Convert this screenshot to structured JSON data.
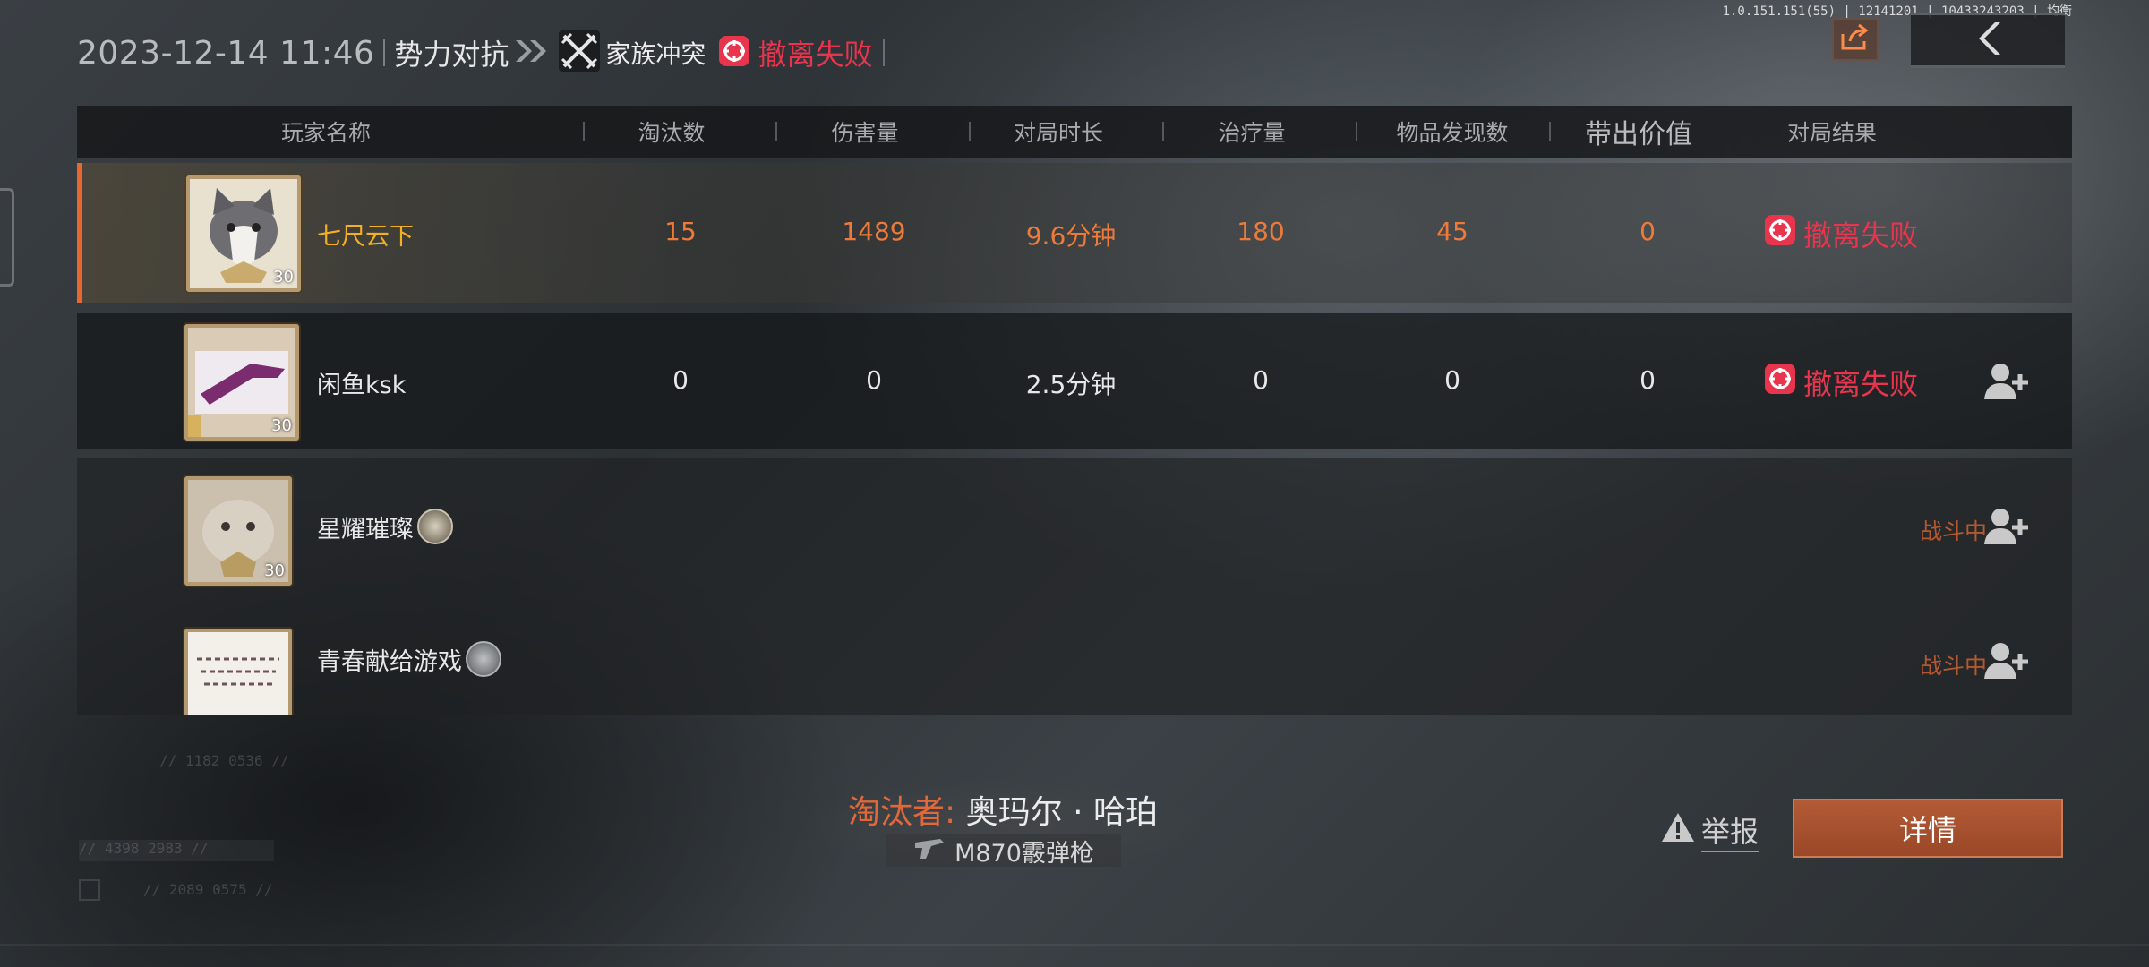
{
  "header": {
    "datetime": "2023-12-14 11:46",
    "mode": "势力对抗",
    "submode": "家族冲突",
    "result": "撤离失败"
  },
  "version": "1.0.151.151(55) | 12141201 | 10433243203 | 均衡",
  "columns": {
    "player": "玩家名称",
    "kills": "淘汰数",
    "damage": "伤害量",
    "duration": "对局时长",
    "healing": "治疗量",
    "items": "物品发现数",
    "value": "带出价值",
    "result": "对局结果"
  },
  "players": [
    {
      "name": "七尺云下",
      "level": "30",
      "kills": "15",
      "damage": "1489",
      "duration": "9.6分钟",
      "healing": "180",
      "items": "45",
      "value": "0",
      "result": "撤离失败"
    },
    {
      "name": "闲鱼ksk",
      "level": "30",
      "kills": "0",
      "damage": "0",
      "duration": "2.5分钟",
      "healing": "0",
      "items": "0",
      "value": "0",
      "result": "撤离失败"
    },
    {
      "name": "星耀璀璨",
      "level": "30",
      "status": "战斗中..."
    },
    {
      "name": "青春献给游戏",
      "status": "战斗中..."
    }
  ],
  "killer": {
    "label": "淘汰者:",
    "name": "奥玛尔 · 哈珀",
    "weapon": "M870霰弹枪"
  },
  "actions": {
    "report": "举报",
    "details": "详情"
  },
  "deco": {
    "coord1": "// 1182 0536 //",
    "code": "// 4398 2983 //",
    "coord2": "// 2089 0575 //"
  },
  "colors": {
    "accent": "#e8662f",
    "fail": "#e8354d",
    "highlight": "#ee7a3a",
    "my_name": "#f4b020",
    "detail_button": "#a9502f"
  },
  "icons": {
    "chevrons": "double-chevron-right-icon",
    "mode": "crossed-swords-icon",
    "fail": "fail-badge-icon",
    "share": "share-icon",
    "back": "back-arrow-icon",
    "add_friend": "add-friend-icon",
    "warning": "warning-triangle-icon",
    "weapon": "shotgun-icon"
  }
}
